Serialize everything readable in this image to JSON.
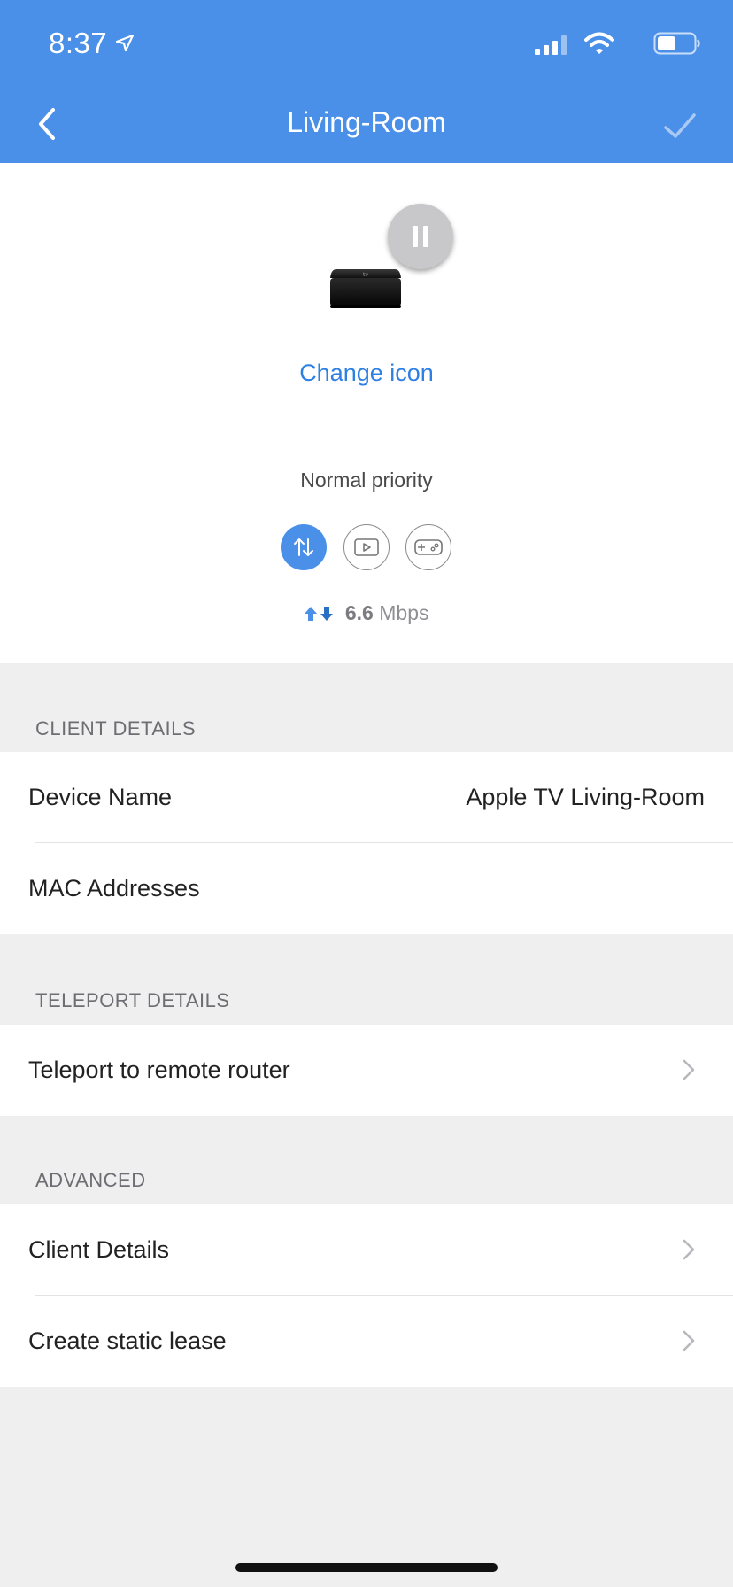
{
  "status_bar": {
    "time": "8:37"
  },
  "nav": {
    "title": "Living-Room"
  },
  "device": {
    "change_icon_label": "Change icon",
    "priority_label": "Normal priority",
    "speed_value": "6.6",
    "speed_unit": "Mbps"
  },
  "sections": {
    "client_details": {
      "header": "CLIENT DETAILS",
      "rows": [
        {
          "label": "Device Name",
          "value": "Apple TV Living-Room"
        },
        {
          "label": "MAC Addresses"
        }
      ]
    },
    "teleport_details": {
      "header": "TELEPORT DETAILS",
      "rows": [
        {
          "label": "Teleport to remote router"
        }
      ]
    },
    "advanced": {
      "header": "ADVANCED",
      "rows": [
        {
          "label": "Client Details"
        },
        {
          "label": "Create static lease"
        }
      ]
    }
  },
  "colors": {
    "accent": "#4a90e8",
    "link": "#2f80e3",
    "background": "#efeff0"
  }
}
